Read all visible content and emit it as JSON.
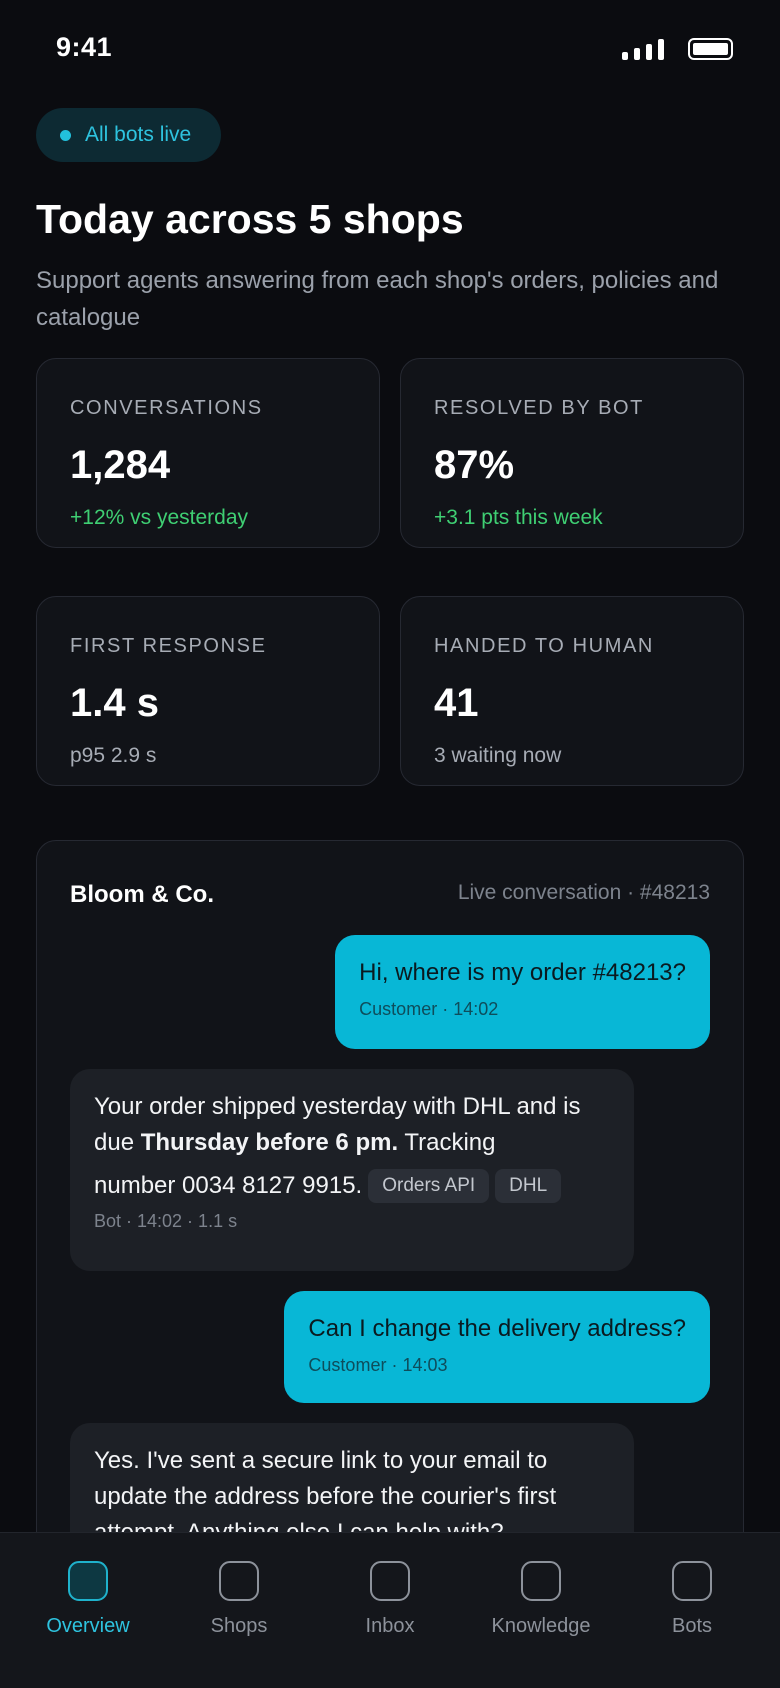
{
  "status_bar": {
    "time": "9:41"
  },
  "header": {
    "live_pill": "All bots live",
    "title": "Today across 5 shops",
    "subtitle": "Support agents answering from each shop's orders, policies and catalogue"
  },
  "stats": [
    {
      "label": "CONVERSATIONS",
      "value": "1,284",
      "delta": "+12% vs yesterday"
    },
    {
      "label": "RESOLVED BY BOT",
      "value": "87%",
      "delta": "+3.1 pts this week"
    },
    {
      "label": "FIRST RESPONSE",
      "value": "1.4 s",
      "delta": "p95 2.9 s"
    },
    {
      "label": "HANDED TO HUMAN",
      "value": "41",
      "delta": "3 waiting now"
    }
  ],
  "conversation": {
    "shop": "Bloom & Co.",
    "meta": "Live conversation · #48213",
    "messages": [
      {
        "role": "customer",
        "text": "Hi, where is my order #48213?",
        "meta": "Customer · 14:02"
      },
      {
        "role": "bot",
        "text_a": "Your order shipped yesterday with DHL and is due ",
        "text_bold": "Thursday before 6 pm.",
        "text_b": " Tracking",
        "text_c": "number 0034 8127 9915.",
        "chips": [
          "Orders API",
          "DHL"
        ],
        "meta": "Bot · 14:02 · 1.1 s"
      },
      {
        "role": "customer",
        "text": "Can I change the delivery address?",
        "meta": "Customer · 14:03"
      },
      {
        "role": "bot",
        "text": "Yes. I've sent a secure link to your email to update the address before the courier's first attempt. Anything else I can help with?"
      }
    ]
  },
  "tabs": [
    {
      "label": "Overview",
      "active": true
    },
    {
      "label": "Shops"
    },
    {
      "label": "Inbox"
    },
    {
      "label": "Knowledge"
    },
    {
      "label": "Bots"
    }
  ],
  "colors": {
    "accent": "#08b7d6",
    "positive": "#3fcf73",
    "background": "#0b0c10",
    "card": "#111318"
  }
}
